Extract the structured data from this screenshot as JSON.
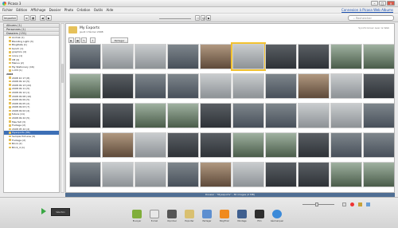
{
  "window": {
    "title": "Picasa 3"
  },
  "menu": [
    "Fichier",
    "Edition",
    "Affichage",
    "Dossier",
    "Photo",
    "Création",
    "Outils",
    "Aide"
  ],
  "signin": "Connexion à Picasa Web Albums",
  "toolbar": {
    "import_label": "Importer",
    "search_placeholder": "Rechercher"
  },
  "sidebar": {
    "sections": [
      "Albums (1)",
      "Personnes (1)",
      "Dossiers (151)"
    ],
    "items_top": [
      "Animal (1)",
      "Blending Light (3)",
      "BlogDate (1)",
      "bench (1)",
      "graphics (4)",
      "icone (1)",
      "CB (4)",
      "Menus (2)",
      "My Stationary (16)",
      "n-IVII (1)"
    ],
    "year": "2008",
    "items_year": [
      "2008 10 17 (8)",
      "2008 09 12 (5)",
      "2008 09 13 (22)",
      "2008 09 11 (5)",
      "2008 09 12 (1)",
      "2008 09 08 (10)",
      "2008 09 09 (5)",
      "2008 09 05 (2)",
      "2008 09 03 (7)",
      "2008 09 02 (4)",
      "futura (11)",
      "2008 09 22 (5)",
      "Mes fait (3)",
      "Footage (2)",
      "2008 05 22 (4)",
      "Myexports (36)",
      "Sample Pictures (9)",
      "Footage (2)",
      "Brick (2)",
      "Brick_4 (1)"
    ],
    "selected_index": 15
  },
  "album": {
    "title": "My Exports",
    "meta": "jeudi 1 février 2008",
    "desc": "Synchroniser avec le Web",
    "button_label": "Partager"
  },
  "status": "Dossier : \"Myexports\" - 36 images (2 MB)",
  "tray": {
    "selection_label": "Sélection",
    "actions": [
      "Envoyer",
      "E-mail",
      "Imprimer",
      "Exporter",
      "Partager",
      "BlogThis!",
      "Montage",
      "Film",
      "Géomarquer"
    ]
  }
}
